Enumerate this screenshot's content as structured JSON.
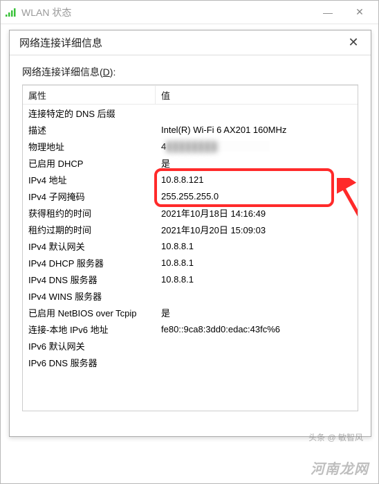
{
  "outer": {
    "title": "WLAN 状态",
    "minimize": "—",
    "close": "✕"
  },
  "inner": {
    "title": "网络连接详细信息",
    "close": "✕",
    "sectionLabelPrefix": "网络连接详细信息(",
    "sectionLabelKey": "D",
    "sectionLabelSuffix": "):",
    "headerProp": "属性",
    "headerVal": "值"
  },
  "rows": [
    {
      "prop": "连接特定的 DNS 后缀",
      "val": ""
    },
    {
      "prop": "描述",
      "val": "Intel(R) Wi-Fi 6 AX201 160MHz"
    },
    {
      "prop": "物理地址",
      "val": "4",
      "blurred": true
    },
    {
      "prop": "已启用 DHCP",
      "val": "是"
    },
    {
      "prop": "IPv4 地址",
      "val": "10.8.8.121"
    },
    {
      "prop": "IPv4 子网掩码",
      "val": "255.255.255.0"
    },
    {
      "prop": "获得租约的时间",
      "val": "2021年10月18日 14:16:49"
    },
    {
      "prop": "租约过期的时间",
      "val": "2021年10月20日 15:09:03"
    },
    {
      "prop": "IPv4 默认网关",
      "val": "10.8.8.1"
    },
    {
      "prop": "IPv4 DHCP 服务器",
      "val": "10.8.8.1"
    },
    {
      "prop": "IPv4 DNS 服务器",
      "val": "10.8.8.1"
    },
    {
      "prop": "IPv4 WINS 服务器",
      "val": ""
    },
    {
      "prop": "已启用 NetBIOS over Tcpip",
      "val": "是"
    },
    {
      "prop": "连接-本地 IPv6 地址",
      "val": "fe80::9ca8:3dd0:edac:43fc%6"
    },
    {
      "prop": "IPv6 默认网关",
      "val": ""
    },
    {
      "prop": "IPv6 DNS 服务器",
      "val": ""
    }
  ],
  "watermark1": "头条 @ 敏智风",
  "watermark2": "河南龙网"
}
